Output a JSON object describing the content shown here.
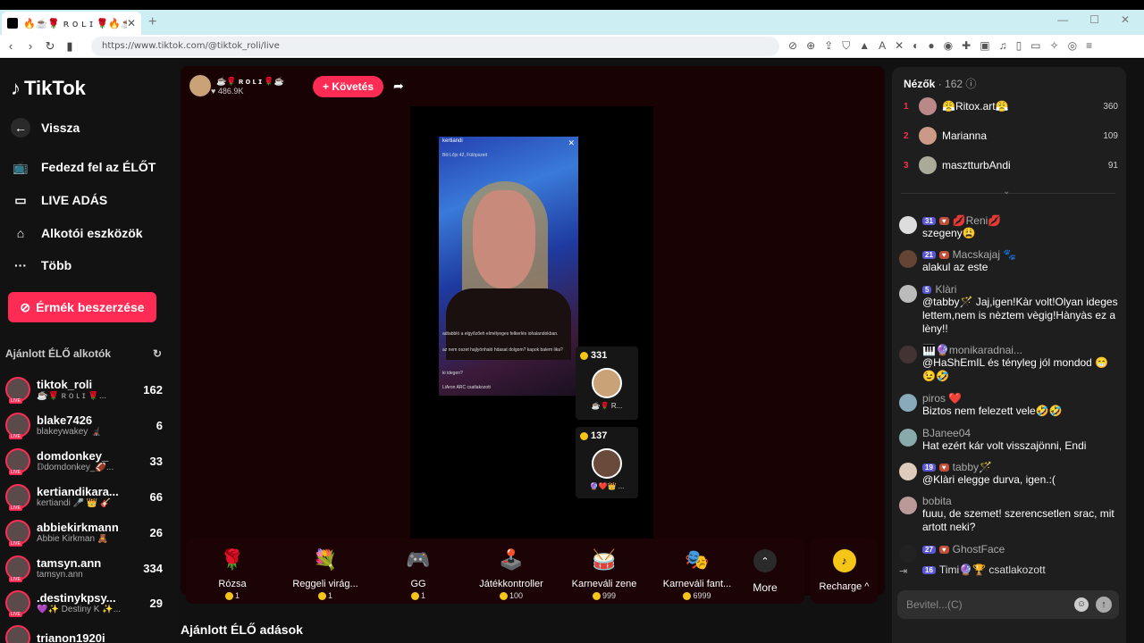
{
  "browser": {
    "tab_title": "🔥☕️🌹 ʀ ᴏ ʟ ɪ 🌹🔥☕️ (@t",
    "url": "https://www.tiktok.com/@tiktok_roli/live"
  },
  "nav": {
    "logo": "TikTok",
    "items": [
      {
        "label": "Vissza",
        "icon": "back-arrow-icon"
      },
      {
        "label": "Fedezd fel az ÉLŐT",
        "icon": "tv-icon"
      },
      {
        "label": "LIVE ADÁS",
        "icon": "camera-icon"
      },
      {
        "label": "Alkotói eszközök",
        "icon": "lightbulb-icon"
      },
      {
        "label": "Több",
        "icon": "more-dots-icon"
      }
    ],
    "coin_button": "Érmék beszerzése",
    "recommended_header": "Ajánlott ÉLŐ alkotók"
  },
  "creators": [
    {
      "name": "tiktok_roli",
      "sub": "☕️🌹 ʀ ᴏ ʟ ɪ 🌹...",
      "count": "162"
    },
    {
      "name": "blake7426",
      "sub": "blakeywakey 🦼",
      "count": "6"
    },
    {
      "name": "domdonkey_",
      "sub": "𝔻domdonkey_🏈...",
      "count": "33"
    },
    {
      "name": "kertiandikara...",
      "sub": "kertiandi 🎤 👑 🎸",
      "count": "66"
    },
    {
      "name": "abbiekirkmann",
      "sub": "Abbie Kirkman 🧸",
      "count": "26"
    },
    {
      "name": "tamsyn.ann",
      "sub": "tamsyn.ann",
      "count": "334"
    },
    {
      "name": ".destinykpsy...",
      "sub": "💜✨ Destiny K ✨...",
      "count": "29"
    },
    {
      "name": "trianon1920i",
      "sub": "",
      "count": ""
    }
  ],
  "stream": {
    "host_name": "☕️🌹 ʀ ᴏ ʟ ɪ 🌹☕️",
    "host_likes": "♥ 486.9K",
    "follow_label": "+ Követés",
    "inner": {
      "user": "kertiandi",
      "location": "Bili Lőjo 42, Fülöpszeit",
      "comment1": "adtabbló a elgyőzőeh elmélyeges felkerlés iohalandokban.",
      "comment2": "az nem oszet hajlyónhaló hdasat dolgom? kapok balem lika?",
      "comment3": "ki idegen?",
      "joined": "LiAron ARC csatlakozott"
    },
    "tiles": [
      {
        "amount": "331",
        "label": "☕️🌹 R..."
      },
      {
        "amount": "137",
        "label": "🔮❤️👑 ..."
      }
    ]
  },
  "gifts": [
    {
      "name": "Rózsa",
      "price": "1",
      "icon": "🌹"
    },
    {
      "name": "Reggeli virág...",
      "price": "1",
      "icon": "💐"
    },
    {
      "name": "GG",
      "price": "1",
      "icon": "🎮"
    },
    {
      "name": "Játékkontroller",
      "price": "100",
      "icon": "🕹️"
    },
    {
      "name": "Karneváli zene",
      "price": "999",
      "icon": "🥁"
    },
    {
      "name": "Karneváli fant...",
      "price": "6999",
      "icon": "🎭"
    }
  ],
  "more_label": "More",
  "recharge_label": "Recharge ^",
  "recommended_live": "Ajánlott ÉLŐ adások",
  "chat": {
    "viewers_label": "Nézők",
    "viewers_count": "· 162",
    "top_viewers": [
      {
        "rank": "1",
        "name": "😤Ritox.art😤",
        "score": "360"
      },
      {
        "rank": "2",
        "name": "Marianna",
        "score": "109"
      },
      {
        "rank": "3",
        "name": "masztturbAndi",
        "score": "91"
      }
    ],
    "messages": [
      {
        "badge": "31",
        "user": "💋Reni💋",
        "text": "szegeny😩"
      },
      {
        "badge": "21",
        "user": "Macskajaj 🐾",
        "text": "alakul az este"
      },
      {
        "badge": "5",
        "user": "Klàri",
        "text": "@tabby🪄 Jaj,igen!Kàr volt!Olyan ideges lettem,nem is nèztem vègig!Hànyàs ez a lèny!!"
      },
      {
        "badge": "",
        "user": "🎹🔮monikaradnai...",
        "text": "@HaShEmIL és tényleg jól mondod 😁😉🤣"
      },
      {
        "badge": "",
        "user": "piros ❤️",
        "text": "Biztos nem felezett vele🤣🤣"
      },
      {
        "badge": "",
        "user": "BJanee04",
        "text": "Hat ezért kár volt visszajönni, Endi"
      },
      {
        "badge": "19",
        "user": "tabby🪄",
        "text": "@Klàri elegge durva, igen.:("
      },
      {
        "badge": "",
        "user": "bobita",
        "text": "fuuu, de szemet! szerencsetlen srac, mit artott neki?"
      },
      {
        "badge": "27",
        "user": "GhostFace",
        "text": ""
      },
      {
        "badge": "16",
        "user": "Timi🔮🏆 csatlakozott",
        "text": ""
      }
    ],
    "input_placeholder": "Bevitel...(C)"
  }
}
